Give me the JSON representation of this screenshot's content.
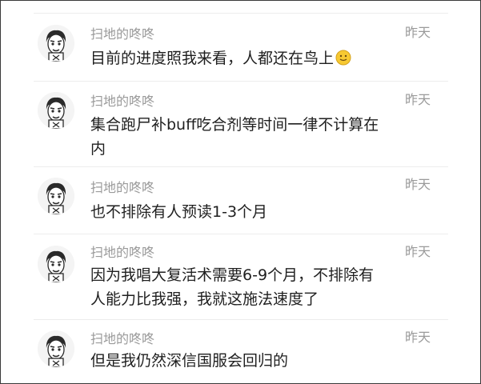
{
  "comments": [
    {
      "username": "扫地的咚咚",
      "time": "昨天",
      "text": "目前的进度照我来看，人都还在鸟上",
      "emoji": "smile-emoji"
    },
    {
      "username": "扫地的咚咚",
      "time": "昨天",
      "text": "集合跑尸补buff吃合剂等时间一律不计算在内"
    },
    {
      "username": "扫地的咚咚",
      "time": "昨天",
      "text": "也不排除有人预读1-3个月"
    },
    {
      "username": "扫地的咚咚",
      "time": "昨天",
      "text": "因为我唱大复活术需要6-9个月，不排除有人能力比我强，我就这施法速度了"
    },
    {
      "username": "扫地的咚咚",
      "time": "昨天",
      "text": "但是我仍然深信国服会回归的"
    }
  ],
  "colors": {
    "border": "#3a3a3a",
    "divider": "#ececec",
    "meta_text": "#9a9a9a",
    "body_text": "#1f1f1f",
    "emoji_face": "#f7c932"
  },
  "icons": {
    "avatar": "cartoon-face-avatar-icon",
    "emoji": "smile-emoji-icon"
  }
}
